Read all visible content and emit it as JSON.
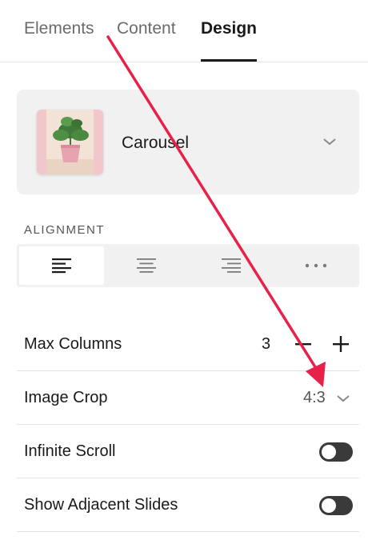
{
  "tabs": [
    {
      "label": "Elements",
      "active": false
    },
    {
      "label": "Content",
      "active": false
    },
    {
      "label": "Design",
      "active": true
    }
  ],
  "block": {
    "name": "Carousel",
    "thumbnail_icon": "potted-plant-image",
    "chevron_icon": "chevron-down-icon"
  },
  "alignment": {
    "label": "ALIGNMENT",
    "options": [
      {
        "icon": "align-left-icon",
        "selected": true
      },
      {
        "icon": "align-center-icon",
        "selected": false
      },
      {
        "icon": "align-right-icon",
        "selected": false
      },
      {
        "icon": "more-dots-icon",
        "selected": false
      }
    ]
  },
  "settings": {
    "max_columns": {
      "label": "Max Columns",
      "value": "3"
    },
    "image_crop": {
      "label": "Image Crop",
      "value": "4:3"
    },
    "infinite_scroll": {
      "label": "Infinite Scroll",
      "enabled": false
    },
    "show_adjacent_slides": {
      "label": "Show Adjacent Slides",
      "enabled": false
    }
  },
  "annotation": {
    "color": "#e8214a",
    "description": "red arrow pointing to image crop dropdown"
  },
  "colors": {
    "accent": "#1a1a1a",
    "panel_bg": "#f1f1f1",
    "toggle_off": "#3a3a3a"
  }
}
